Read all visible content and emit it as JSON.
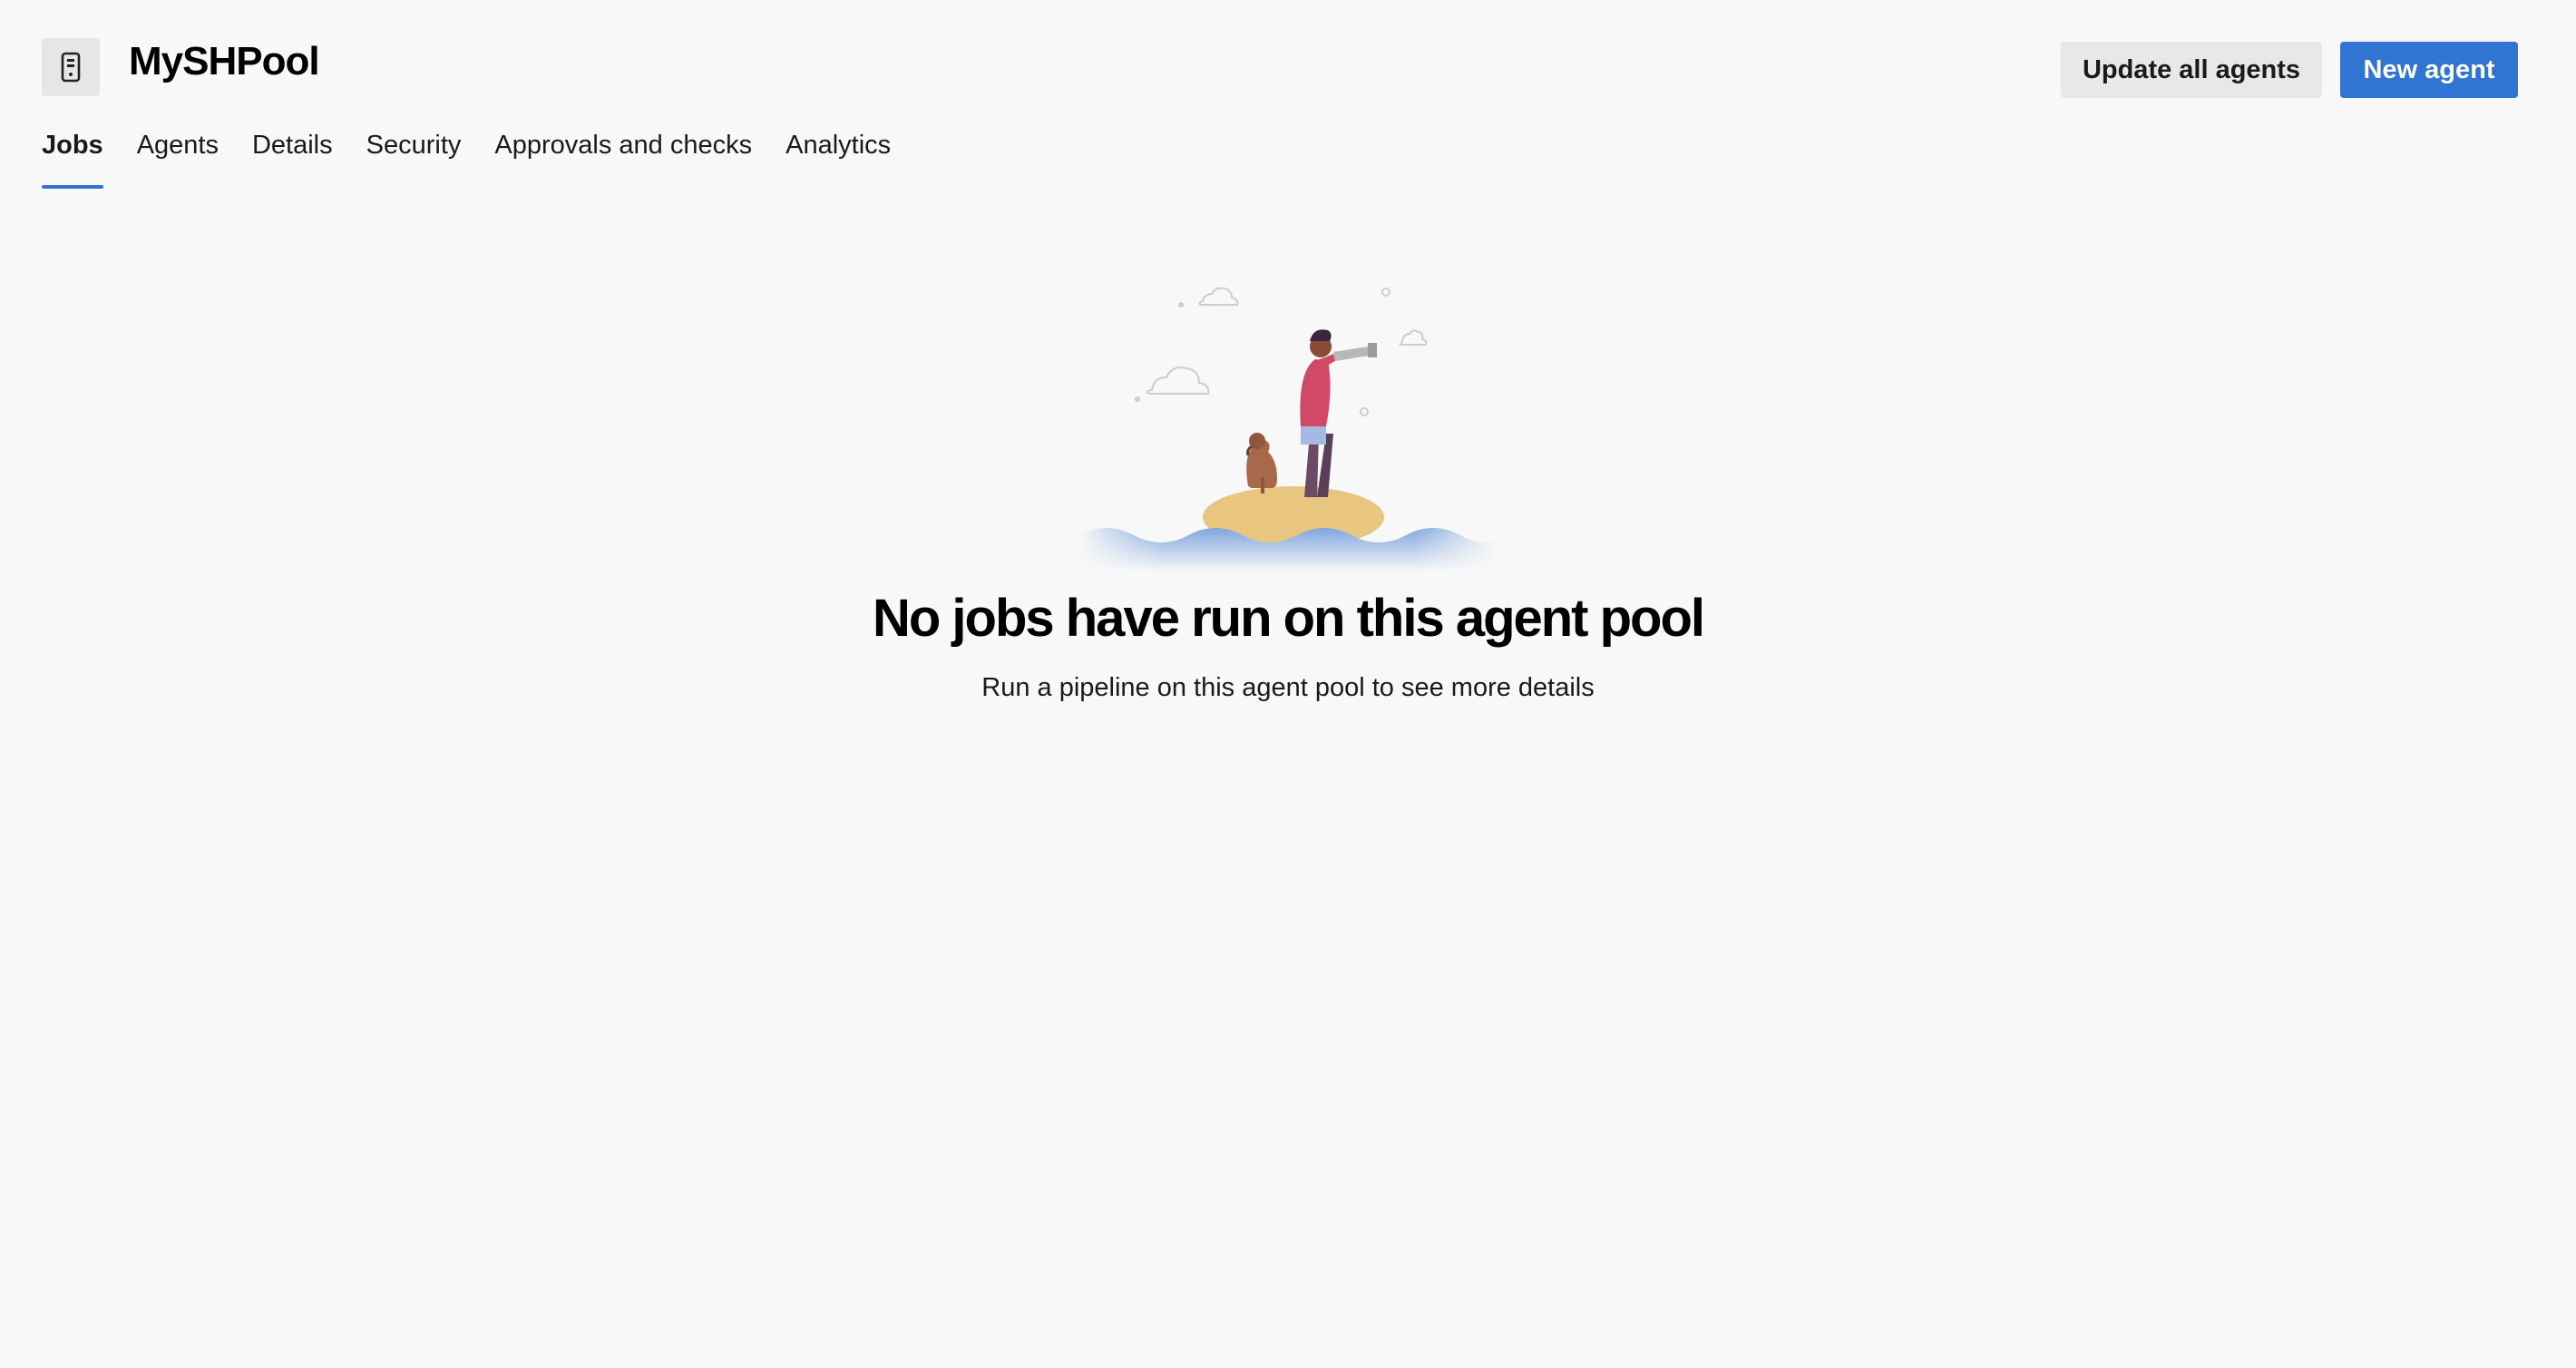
{
  "header": {
    "pool_name": "MySHPool",
    "pool_icon": "agent-pool-icon",
    "update_button_label": "Update all agents",
    "new_agent_button_label": "New agent"
  },
  "tabs": [
    {
      "label": "Jobs",
      "active": true
    },
    {
      "label": "Agents",
      "active": false
    },
    {
      "label": "Details",
      "active": false
    },
    {
      "label": "Security",
      "active": false
    },
    {
      "label": "Approvals and checks",
      "active": false
    },
    {
      "label": "Analytics",
      "active": false
    }
  ],
  "empty_state": {
    "illustration": "person-with-telescope-and-dog-on-island-illustration",
    "title": "No jobs have run on this agent pool",
    "subtitle": "Run a pipeline on this agent pool to see more details"
  },
  "colors": {
    "accent": "#2f75d1",
    "background": "#f8f8f8",
    "secondary_button": "#e8e8e8"
  }
}
